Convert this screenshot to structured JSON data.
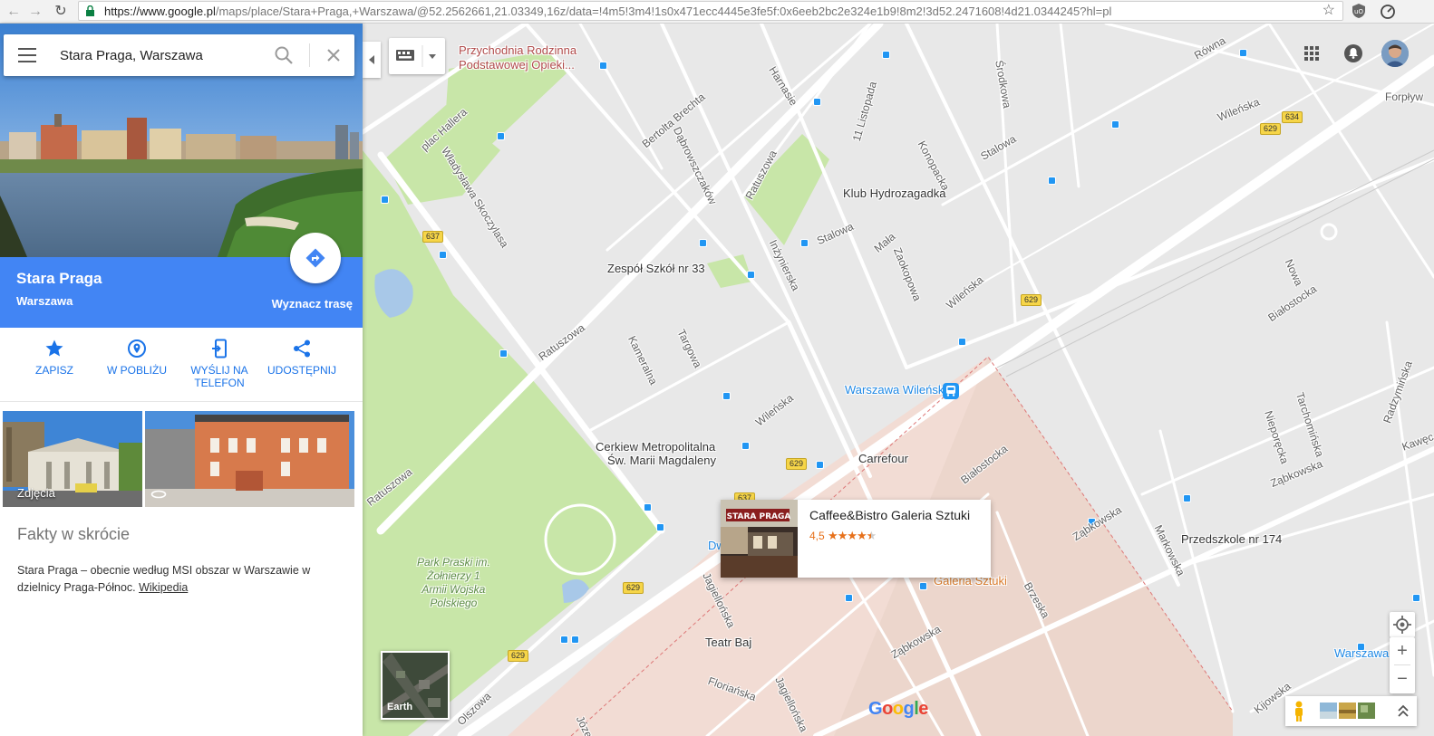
{
  "browser": {
    "url_main": "https://www.google.pl",
    "url_rest": "/maps/place/Stara+Praga,+Warszawa/@52.2562661,21.03349,16z/data=!4m5!3m4!1s0x471ecc4445e3fe5f:0x6eeb2bc2e324e1b9!8m2!3d52.2471608!4d21.0344245?hl=pl"
  },
  "search": {
    "value": "Stara Praga, Warszawa"
  },
  "place": {
    "title": "Stara Praga",
    "subtitle": "Warszawa",
    "route_label": "Wyznacz trasę"
  },
  "actions": [
    {
      "label": "ZAPISZ"
    },
    {
      "label": "W POBLIŻU"
    },
    {
      "label": "WYŚLIJ NA TELEFON"
    },
    {
      "label": "UDOSTĘPNIJ"
    }
  ],
  "photos": {
    "label": "Zdjęcia"
  },
  "facts": {
    "title": "Fakty w skrócie",
    "text": "Stara Praga – obecnie według MSI obszar w Warszawie w dzielnicy Praga-Północ.",
    "link": "Wikipedia"
  },
  "map": {
    "streets": [
      {
        "text": "plac Hallera"
      },
      {
        "text": "Władysława Skoczylasa"
      },
      {
        "text": "Bertolta Brechta"
      },
      {
        "text": "Dąbrowszczaków"
      },
      {
        "text": "Ratuszowa"
      },
      {
        "text": "Ratuszowa"
      },
      {
        "text": "Ratuszowa"
      },
      {
        "text": "Inżynierska"
      },
      {
        "text": "Stalowa"
      },
      {
        "text": "Stalowa"
      },
      {
        "text": "Konopacka"
      },
      {
        "text": "Środkowa"
      },
      {
        "text": "Równa"
      },
      {
        "text": "Wileńska"
      },
      {
        "text": "Wileńska"
      },
      {
        "text": "Wileńska"
      },
      {
        "text": "Mała"
      },
      {
        "text": "Zaokopowa"
      },
      {
        "text": "Kameralna"
      },
      {
        "text": "Targowa"
      },
      {
        "text": "Białostocka"
      },
      {
        "text": "Białostocka"
      },
      {
        "text": "Nowa"
      },
      {
        "text": "Ząbkowska"
      },
      {
        "text": "Ząbkowska"
      },
      {
        "text": "Ząbkowska"
      },
      {
        "text": "Markowska"
      },
      {
        "text": "Brzeska"
      },
      {
        "text": "Jagiellońska"
      },
      {
        "text": "Jagiellońska"
      },
      {
        "text": "Floriańska"
      },
      {
        "text": "Olszowa"
      },
      {
        "text": "Kijowska"
      },
      {
        "text": "Tarchomińska"
      },
      {
        "text": "Nieporęcka"
      },
      {
        "text": "Radzymińska"
      },
      {
        "text": "Kawęc"
      },
      {
        "text": "Harnasie"
      },
      {
        "text": "11 Listopada"
      },
      {
        "text": "Forpływ"
      },
      {
        "text": "Józe"
      }
    ],
    "pois": [
      {
        "text": "Przychodnia Rodzinna"
      },
      {
        "text": "Podstawowej Opieki..."
      },
      {
        "text": "Klub Hydrozagadka"
      },
      {
        "text": "Zespół Szkół nr 33"
      },
      {
        "text": "Warszawa Wileńska"
      },
      {
        "text": "Cerkiew Metropolitalna"
      },
      {
        "text": "Św. Marii Magdaleny"
      },
      {
        "text": "Carrefour"
      },
      {
        "text": "Przedszkole nr 174"
      },
      {
        "text": "Teatr Baj"
      },
      {
        "text": "Warszawa W"
      },
      {
        "text": "Galeria Sztuki"
      },
      {
        "text": "Dw"
      }
    ],
    "park_label": "Park Praski im.\nŻołnierzy 1\nArmii Wojska\nPolskiego",
    "road_numbers": [
      "637",
      "634",
      "629",
      "629",
      "629",
      "629",
      "637",
      "629"
    ],
    "earth_label": "Earth",
    "logo": "Google"
  },
  "card": {
    "title": "Caffee&Bistro Galeria Sztuki",
    "rating": "4,5",
    "stars": 4.5
  },
  "colors": {
    "accent": "#4285f4",
    "map_bg": "#e8e8e8",
    "park": "#c8e6a8",
    "road": "#ffffff",
    "transit_blue": "#2196f3",
    "rating_orange": "#e7711b"
  }
}
